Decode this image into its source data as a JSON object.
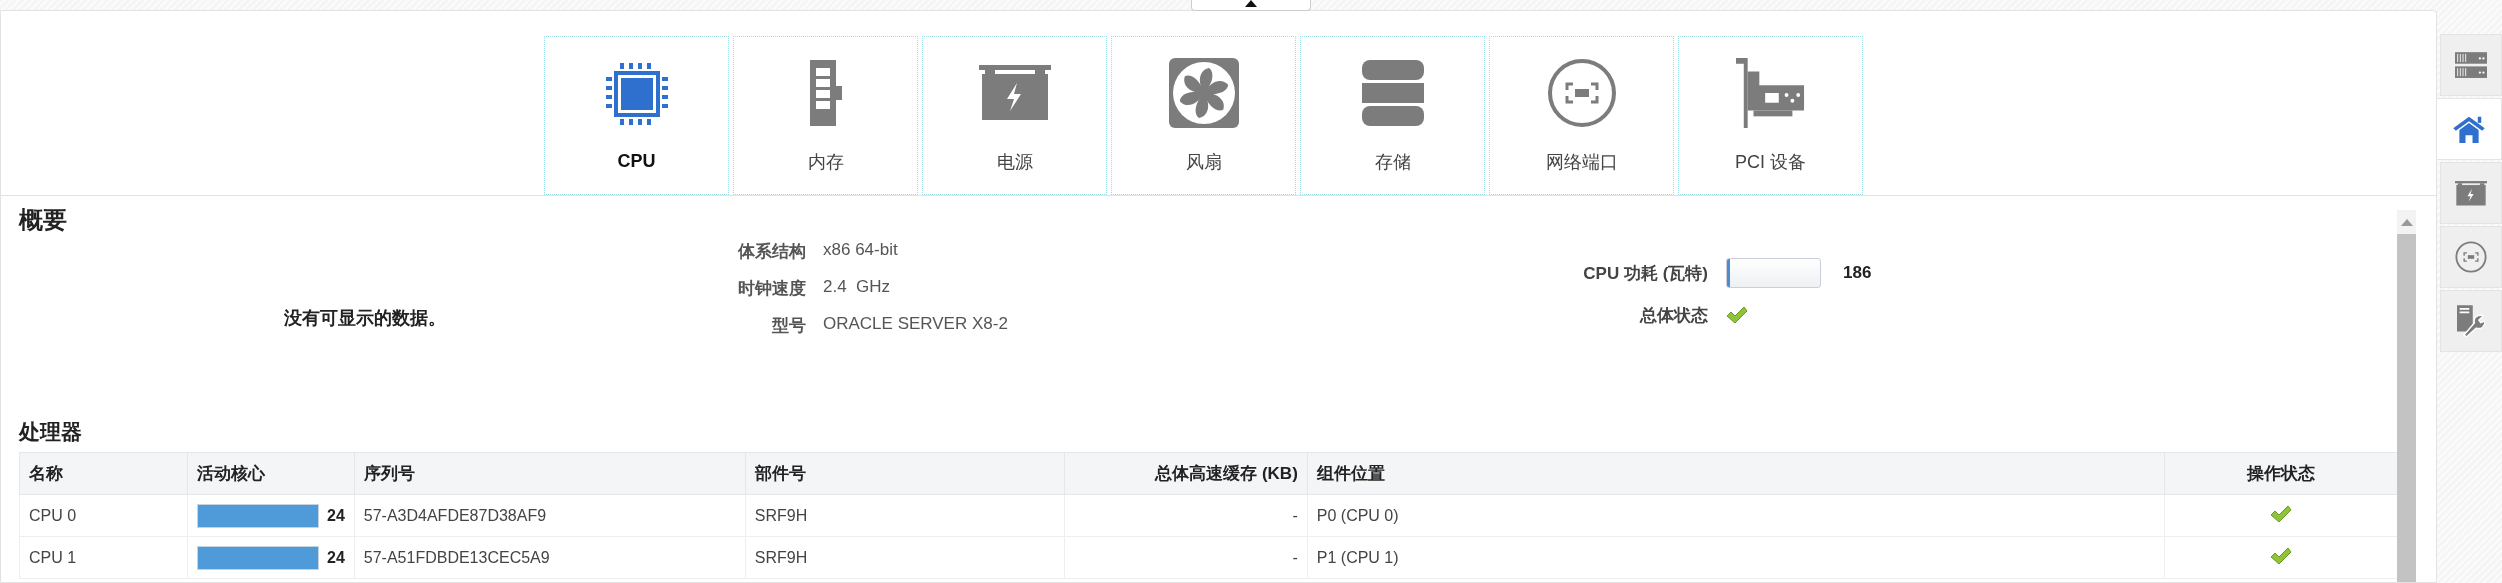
{
  "tabs": [
    {
      "label": "CPU",
      "kind": "cpu",
      "selected": true
    },
    {
      "label": "内存",
      "kind": "memory",
      "selected": false
    },
    {
      "label": "电源",
      "kind": "power",
      "selected": false
    },
    {
      "label": "风扇",
      "kind": "fan",
      "selected": false
    },
    {
      "label": "存储",
      "kind": "storage",
      "selected": false
    },
    {
      "label": "网络端口",
      "kind": "network",
      "selected": false
    },
    {
      "label": "PCI 设备",
      "kind": "pci",
      "selected": false
    }
  ],
  "overview": {
    "title": "概要",
    "message": "没有可显示的数据。",
    "properties": [
      {
        "label": "体系结构",
        "value": "x86 64-bit"
      },
      {
        "label": "时钟速度",
        "value": "2.4  GHz"
      },
      {
        "label": "型号",
        "value": "ORACLE SERVER X8-2"
      }
    ],
    "power": {
      "label": "CPU 功耗 (瓦特)",
      "level": 0.03,
      "reading": "186"
    },
    "health": {
      "label": "总体状态",
      "ok": true
    }
  },
  "processors": {
    "title": "处理器",
    "columns": [
      "名称",
      "活动核心",
      "序列号",
      "部件号",
      "总体高速缓存 (KB)",
      "组件位置",
      "操作状态"
    ],
    "rows": [
      {
        "name": "CPU 0",
        "cores": {
          "level": 1,
          "reading": "24"
        },
        "serial": "57-A3D4AFDE87D38AF9",
        "part": "SRF9H",
        "cache": "-",
        "location": "P0 (CPU 0)",
        "ok": true
      },
      {
        "name": "CPU 1",
        "cores": {
          "level": 1,
          "reading": "24"
        },
        "serial": "57-A51FDBDE13CEC5A9",
        "part": "SRF9H",
        "cache": "-",
        "location": "P1 (CPU 1)",
        "ok": true
      }
    ]
  },
  "sidebar": {
    "items": [
      {
        "kind": "server",
        "selected": false
      },
      {
        "kind": "home",
        "selected": true
      },
      {
        "kind": "power",
        "selected": false
      },
      {
        "kind": "network",
        "selected": false
      },
      {
        "kind": "service",
        "selected": false
      }
    ]
  }
}
